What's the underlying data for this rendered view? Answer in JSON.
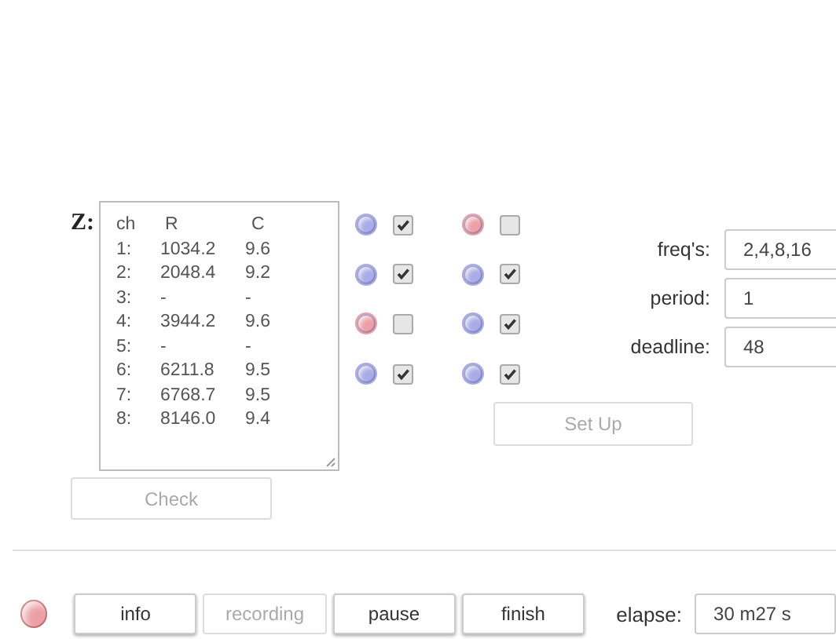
{
  "readout": {
    "label": "Z:",
    "header": [
      "ch",
      "R",
      "C"
    ],
    "rows": [
      [
        "1:",
        "1034.2",
        "9.6"
      ],
      [
        "2:",
        "2048.4",
        "9.2"
      ],
      [
        "3:",
        "-",
        "-"
      ],
      [
        "4:",
        "3944.2",
        "9.6"
      ],
      [
        "5:",
        "-",
        "-"
      ],
      [
        "6:",
        "6211.8",
        "9.5"
      ],
      [
        "7:",
        "6768.7",
        "9.5"
      ],
      [
        "8:",
        "8146.0",
        "9.4"
      ]
    ]
  },
  "check_button": {
    "label": "Check",
    "disabled": true
  },
  "channels": [
    {
      "color": "#a8abe6",
      "checked": true
    },
    {
      "color": "#a8abe6",
      "checked": true
    },
    {
      "color": "#ec9fa6",
      "checked": false
    },
    {
      "color": "#a8abe6",
      "checked": true
    },
    {
      "color": "#ec9fa6",
      "checked": false
    },
    {
      "color": "#a8abe6",
      "checked": true
    },
    {
      "color": "#a8abe6",
      "checked": true
    },
    {
      "color": "#a8abe6",
      "checked": true
    }
  ],
  "settings": [
    {
      "label": "freq's:",
      "value": "2,4,8,16"
    },
    {
      "label": "period:",
      "value": "1"
    },
    {
      "label": "deadline:",
      "value": "48"
    }
  ],
  "setup_button": {
    "label": "Set Up",
    "disabled": true
  },
  "status": {
    "color": "#ec9fa6"
  },
  "buttons": [
    {
      "label": "info",
      "disabled": false
    },
    {
      "label": "recording",
      "disabled": true
    },
    {
      "label": "pause",
      "disabled": false
    },
    {
      "label": "finish",
      "disabled": false
    }
  ],
  "elapse": {
    "label": "elapse:",
    "value": "30 m27 s"
  }
}
